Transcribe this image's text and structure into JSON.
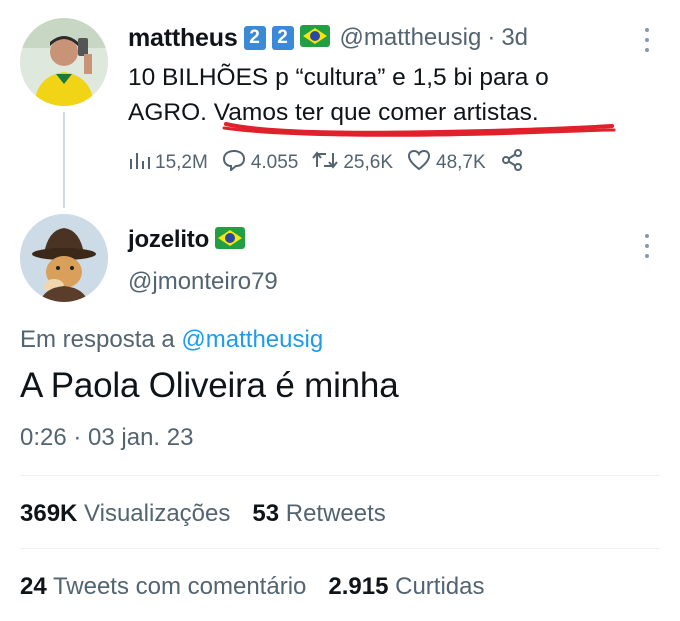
{
  "parent_tweet": {
    "author_name": "mattheus",
    "badges": [
      "2",
      "2"
    ],
    "handle": "@mattheusig",
    "separator": "·",
    "time_ago": "3d",
    "text_line1": "10 BILHÕES p “cultura” e 1,5 bi para o",
    "text_line2_plain": "AGRO. ",
    "text_line2_underlined": "Vamos ter que comer artistas.",
    "underline_color": "#e0202a",
    "metrics": {
      "views": "15,2M",
      "replies": "4.055",
      "retweets": "25,6K",
      "likes": "48,7K"
    }
  },
  "reply_tweet": {
    "author_name": "jozelito",
    "handle": "@jmonteiro79",
    "reply_prefix": "Em resposta a",
    "reply_target": "@mattheusig",
    "text": "A Paola Oliveira é minha",
    "timestamp": "0:26 · 03 jan. 23",
    "stats": {
      "views_count": "369K",
      "views_label": "Visualizações",
      "retweets_count": "53",
      "retweets_label": "Retweets",
      "quotes_count": "24",
      "quotes_label": "Tweets com comentário",
      "likes_count": "2.915",
      "likes_label": "Curtidas"
    }
  },
  "colors": {
    "text_primary": "#0f1419",
    "text_secondary": "#536471",
    "link": "#1d9bf0",
    "badge": "#3a8ad8",
    "divider": "#eff3f4"
  }
}
